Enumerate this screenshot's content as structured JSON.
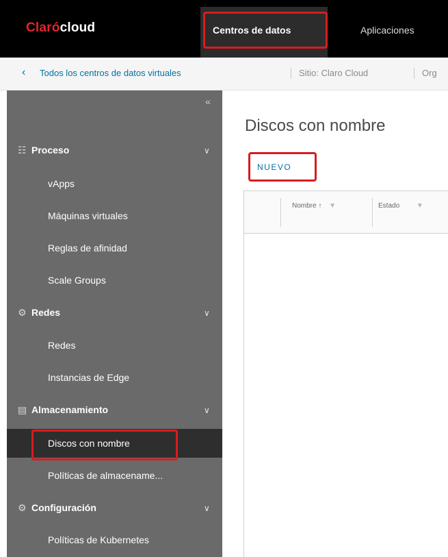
{
  "header": {
    "logo_brand": "Claró",
    "logo_product": "cloud",
    "nav": [
      {
        "label": "Centros de datos",
        "active": true
      },
      {
        "label": "Aplicaciones",
        "active": false
      }
    ]
  },
  "breadcrumb": {
    "back_icon": "chevron-left-icon",
    "link": "Todos los centros de datos virtuales",
    "site": "Sitio: Claro Cloud",
    "org": "Org"
  },
  "sidebar": {
    "collapse_glyph": "«",
    "groups": [
      {
        "label": "Proceso",
        "icon": "grid-icon",
        "items": [
          "vApps",
          "Máquinas virtuales",
          "Reglas de afinidad",
          "Scale Groups"
        ]
      },
      {
        "label": "Redes",
        "icon": "network-icon",
        "items": [
          "Redes",
          "Instancias de Edge"
        ]
      },
      {
        "label": "Almacenamiento",
        "icon": "storage-icon",
        "items": [
          "Discos con nombre",
          "Políticas de almacename..."
        ]
      },
      {
        "label": "Configuración",
        "icon": "gear-icon",
        "items": [
          "Políticas de Kubernetes"
        ]
      }
    ],
    "active_item": "Discos con nombre"
  },
  "main": {
    "title": "Discos con nombre",
    "new_button": "NUEVO",
    "columns": [
      {
        "label": "Nombre ↑",
        "filter_icon": "filter-icon"
      },
      {
        "label": "Estado",
        "filter_icon": "filter-icon"
      }
    ]
  },
  "colors": {
    "header_bg": "#000000",
    "sidebar_bg": "#6a6a6a",
    "active_item_bg": "#2e2e2e",
    "highlight_red": "#d61d20",
    "link_blue": "#0072a3",
    "brand_red": "#e3262b"
  }
}
